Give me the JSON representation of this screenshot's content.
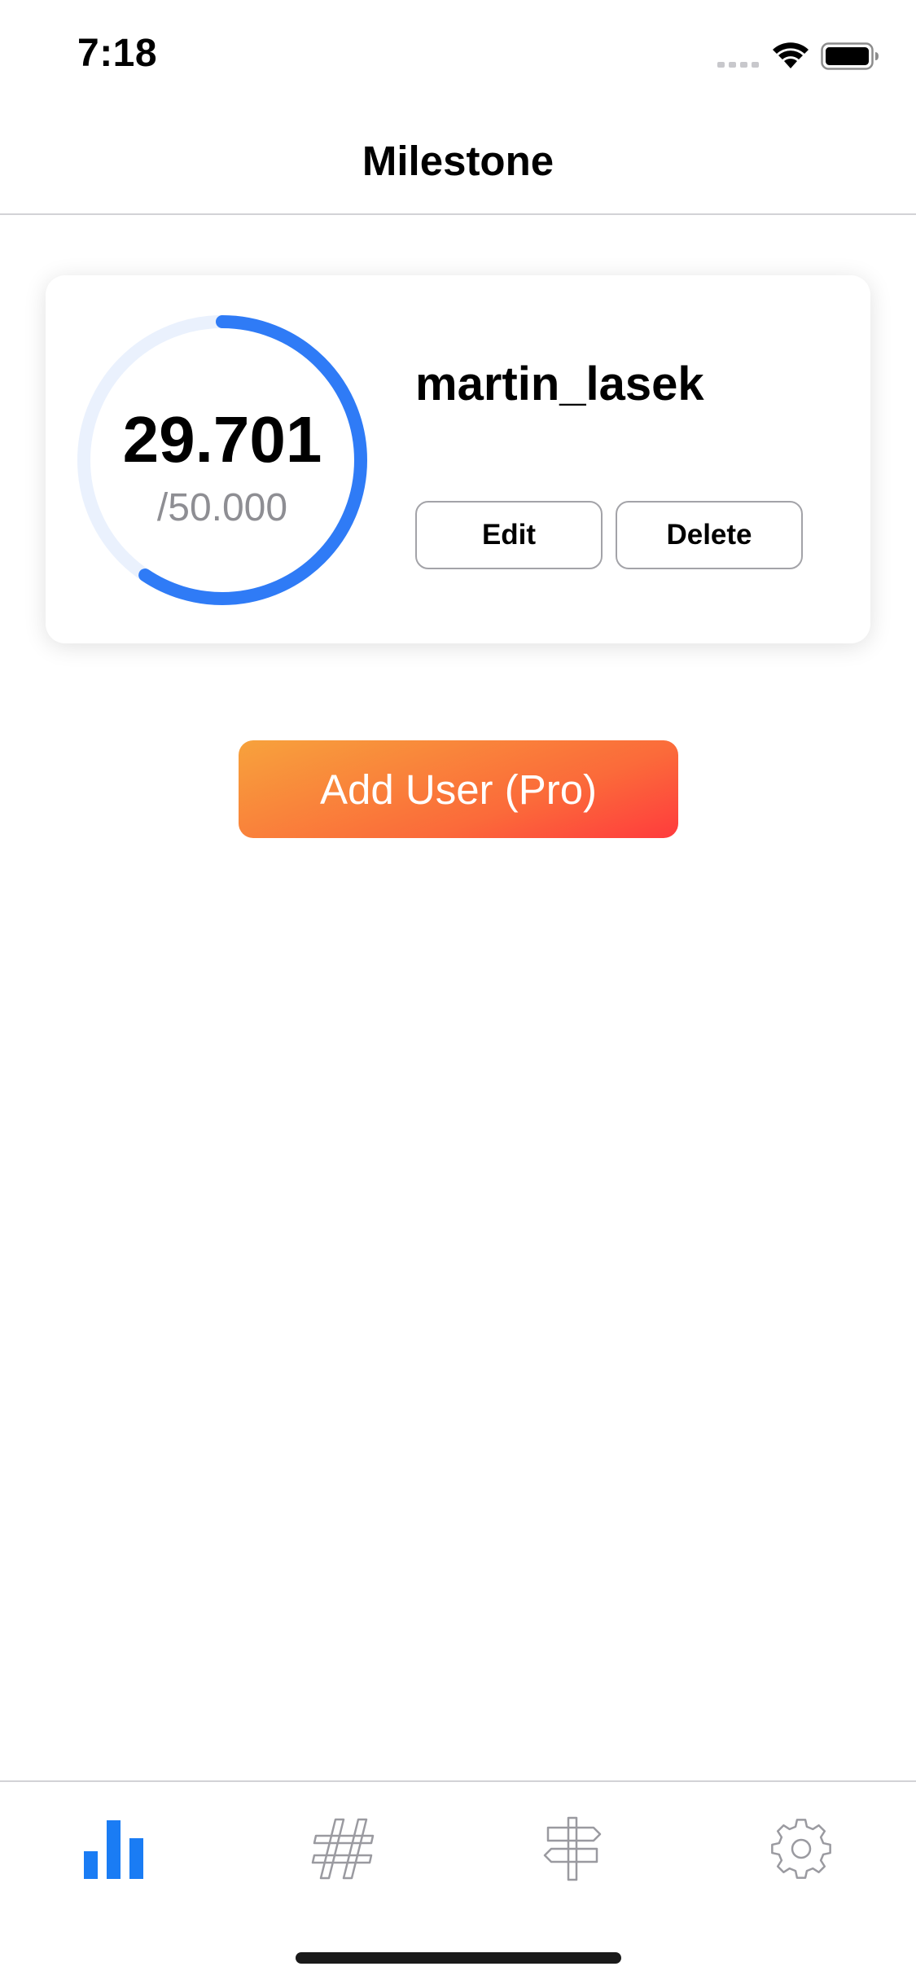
{
  "status_bar": {
    "time": "7:18",
    "signal_icon": "cellular-signal-icon",
    "wifi_icon": "wifi-icon",
    "battery_icon": "battery-icon"
  },
  "nav": {
    "title": "Milestone"
  },
  "card": {
    "current_value": "29.701",
    "goal_label": "/50.000",
    "progress_fraction": 0.594,
    "username": "martin_lasek",
    "edit_label": "Edit",
    "delete_label": "Delete"
  },
  "add_user": {
    "label": "Add User (Pro)"
  },
  "tabs": [
    {
      "icon": "bar-chart-icon",
      "active": true
    },
    {
      "icon": "hashtag-icon",
      "active": false
    },
    {
      "icon": "signpost-icon",
      "active": false
    },
    {
      "icon": "gear-icon",
      "active": false
    }
  ],
  "colors": {
    "accent": "#2f7bf6",
    "ring_track": "#eaf1fd",
    "tab_active": "#1a7cf4",
    "tab_inactive": "#9a9aa0",
    "gradient_start": "#f7a23c",
    "gradient_end": "#ff3b3d"
  }
}
